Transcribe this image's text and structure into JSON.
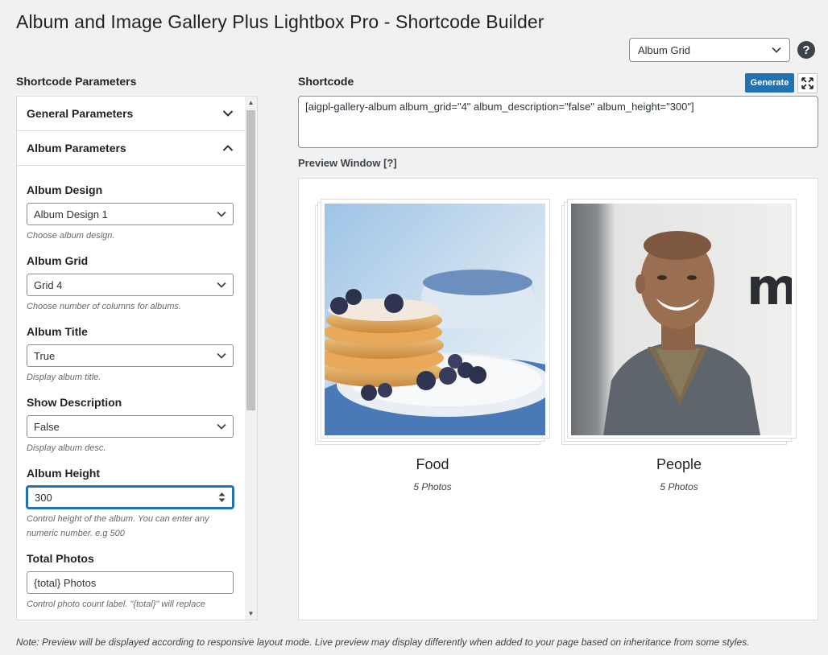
{
  "page": {
    "title": "Album and Image Gallery Plus Lightbox Pro - Shortcode Builder",
    "type_select_value": "Album Grid",
    "help_glyph": "?"
  },
  "left": {
    "heading": "Shortcode Parameters",
    "general_section": "General Parameters",
    "album_section": "Album Parameters",
    "fields": {
      "design": {
        "label": "Album Design",
        "value": "Album Design 1",
        "desc": "Choose album design."
      },
      "grid": {
        "label": "Album Grid",
        "value": "Grid 4",
        "desc": "Choose number of columns for albums."
      },
      "title": {
        "label": "Album Title",
        "value": "True",
        "desc": "Display album title."
      },
      "description": {
        "label": "Show Description",
        "value": "False",
        "desc": "Display album desc."
      },
      "height": {
        "label": "Album Height",
        "value": "300",
        "desc": "Control height of the album. You can enter any numeric number. e.g 500"
      },
      "total": {
        "label": "Total Photos",
        "value": "{total} Photos",
        "desc": "Control photo count label. \"{total}\" will replace"
      }
    }
  },
  "right": {
    "shortcode_heading": "Shortcode",
    "generate_label": "Generate",
    "shortcode_text": "[aigpl-gallery-album album_grid=\"4\" album_description=\"false\" album_height=\"300\"]",
    "preview_heading": "Preview Window [?]"
  },
  "albums": [
    {
      "name": "Food",
      "count": "5 Photos"
    },
    {
      "name": "People",
      "count": "5 Photos"
    }
  ],
  "note": "Note: Preview will be displayed according to responsive layout mode. Live preview may display differently when added to your page based on inheritance from some styles.",
  "colors": {
    "accent": "#2271b1",
    "text": "#1d2327",
    "muted": "#646970"
  }
}
